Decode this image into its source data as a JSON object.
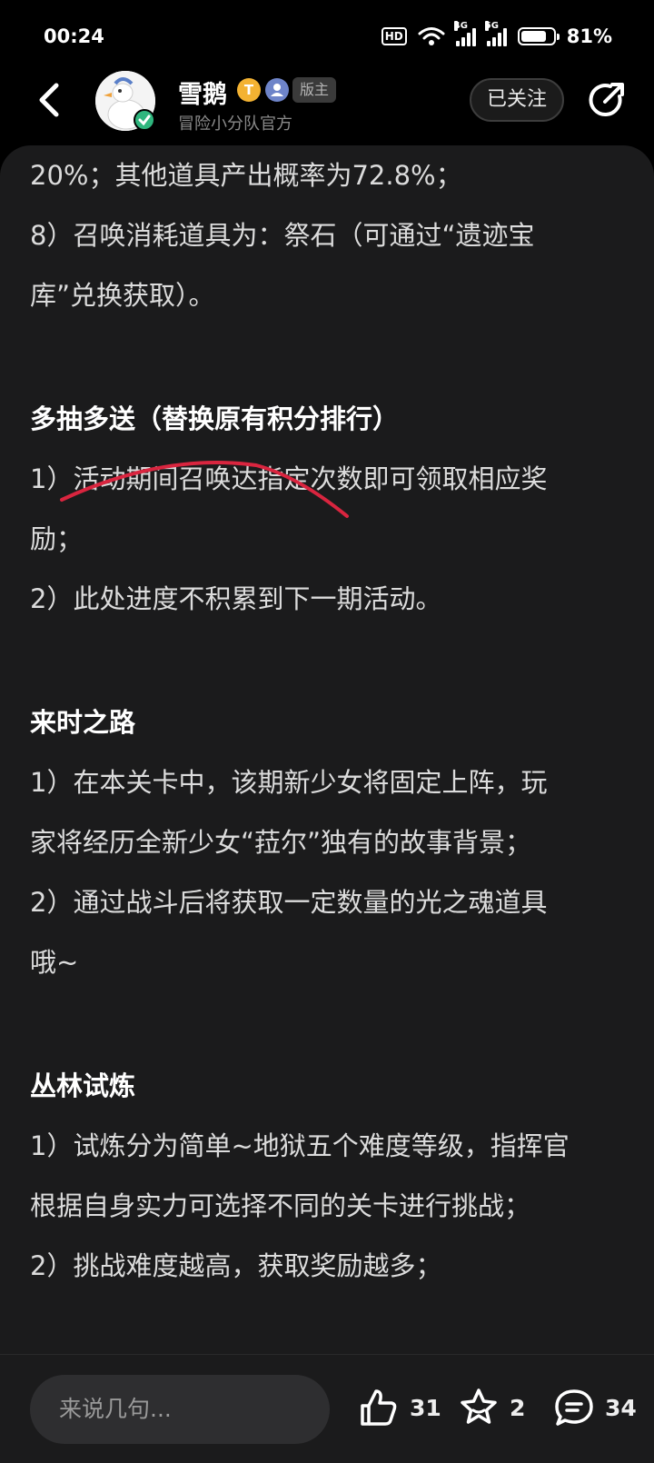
{
  "status_bar": {
    "time": "00:24",
    "hd": "HD",
    "network_1": "4G",
    "network_2": "5G",
    "battery_percent": 81,
    "battery_text": "81%"
  },
  "header": {
    "user_name": "雪鹅",
    "badge_t": "T",
    "role_tag": "版主",
    "subtitle": "冒险小分队官方",
    "follow_label": "已关注"
  },
  "article": {
    "lines": [
      {
        "text": "20%；其他道具产出概率为72.8%；",
        "kind": "body"
      },
      {
        "text": "8）召唤消耗道具为：祭石（可通过“遗迹宝",
        "kind": "body"
      },
      {
        "text": "库”兑换获取）。",
        "kind": "body"
      },
      {
        "text": "",
        "kind": "gap"
      },
      {
        "text": "多抽多送（替换原有积分排行）",
        "kind": "title"
      },
      {
        "text": "1）活动期间召唤达指定次数即可领取相应奖",
        "kind": "body"
      },
      {
        "text": "励；",
        "kind": "body"
      },
      {
        "text": "2）此处进度不积累到下一期活动。",
        "kind": "body"
      },
      {
        "text": "",
        "kind": "gap"
      },
      {
        "text": "来时之路",
        "kind": "title"
      },
      {
        "text": "1）在本关卡中，该期新少女将固定上阵，玩",
        "kind": "body"
      },
      {
        "text": "家将经历全新少女“菈尔”独有的故事背景；",
        "kind": "body"
      },
      {
        "text": "2）通过战斗后将获取一定数量的光之魂道具",
        "kind": "body"
      },
      {
        "text": "哦~",
        "kind": "body"
      },
      {
        "text": "",
        "kind": "gap"
      },
      {
        "text": "丛林试炼",
        "kind": "title"
      },
      {
        "text": "1）试炼分为简单~地狱五个难度等级，指挥官",
        "kind": "body"
      },
      {
        "text": "根据自身实力可选择不同的关卡进行挑战；",
        "kind": "body"
      },
      {
        "text": "2）挑战难度越高，获取奖励越多；",
        "kind": "body"
      }
    ]
  },
  "bottom_bar": {
    "comment_placeholder": "来说几句...",
    "likes": "31",
    "favorites": "2",
    "comments": "34"
  },
  "colors": {
    "background": "#000000",
    "card": "#1b1b1c",
    "annotation_stroke": "#d9253f",
    "avatar_check": "#2fb67e",
    "badge_t": "#f3b232"
  }
}
